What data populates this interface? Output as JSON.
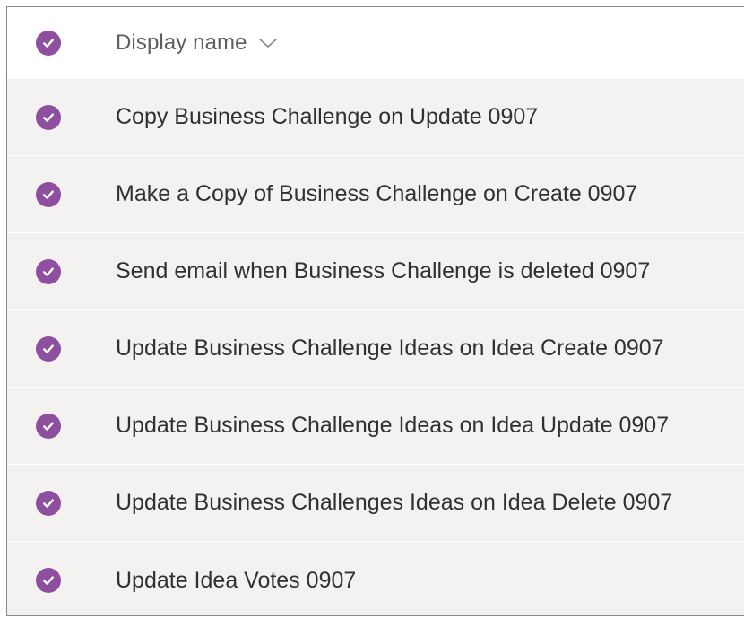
{
  "colors": {
    "accent": "#8e4f9e",
    "row_background": "#f3f2f1",
    "text": "#323130",
    "header_text": "#605e5c"
  },
  "header": {
    "select_all_icon": "checkmark-circle-icon",
    "column_label": "Display name",
    "sort_icon": "chevron-down-icon"
  },
  "rows": [
    {
      "label": "Copy Business Challenge on Update 0907",
      "selected": true
    },
    {
      "label": "Make a Copy of Business Challenge on Create 0907",
      "selected": true
    },
    {
      "label": "Send email when Business Challenge is deleted 0907",
      "selected": true
    },
    {
      "label": "Update Business Challenge Ideas on Idea Create 0907",
      "selected": true
    },
    {
      "label": "Update Business Challenge Ideas on Idea Update 0907",
      "selected": true
    },
    {
      "label": "Update Business Challenges Ideas on Idea Delete 0907",
      "selected": true
    },
    {
      "label": "Update Idea Votes 0907",
      "selected": true
    }
  ]
}
